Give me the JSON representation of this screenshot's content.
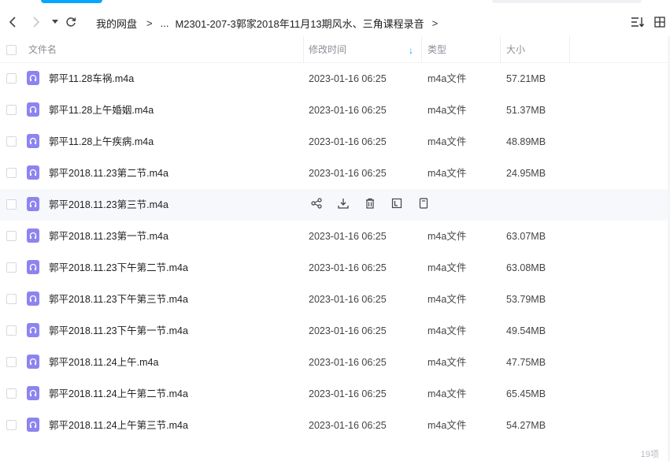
{
  "breadcrumb": {
    "root": "我的网盘",
    "ellipsis": "...",
    "current": "M2301-207-3郭家2018年11月13期风水、三角课程录音"
  },
  "header": {
    "col_name": "文件名",
    "col_modified": "修改时间",
    "col_type": "类型",
    "col_size": "大小"
  },
  "colors": {
    "accent": "#06a7ff",
    "file_icon": "#8d84f0"
  },
  "files": [
    {
      "name": "郭平11.28车祸.m4a",
      "modified": "2023-01-16 06:25",
      "type": "m4a文件",
      "size": "57.21MB"
    },
    {
      "name": "郭平11.28上午婚姻.m4a",
      "modified": "2023-01-16 06:25",
      "type": "m4a文件",
      "size": "51.37MB"
    },
    {
      "name": "郭平11.28上午疾病.m4a",
      "modified": "2023-01-16 06:25",
      "type": "m4a文件",
      "size": "48.89MB"
    },
    {
      "name": "郭平2018.11.23第二节.m4a",
      "modified": "2023-01-16 06:25",
      "type": "m4a文件",
      "size": "24.95MB"
    },
    {
      "name": "郭平2018.11.23第三节.m4a",
      "modified": "",
      "type": "",
      "size": ""
    },
    {
      "name": "郭平2018.11.23第一节.m4a",
      "modified": "2023-01-16 06:25",
      "type": "m4a文件",
      "size": "63.07MB"
    },
    {
      "name": "郭平2018.11.23下午第二节.m4a",
      "modified": "2023-01-16 06:25",
      "type": "m4a文件",
      "size": "63.08MB"
    },
    {
      "name": "郭平2018.11.23下午第三节.m4a",
      "modified": "2023-01-16 06:25",
      "type": "m4a文件",
      "size": "53.79MB"
    },
    {
      "name": "郭平2018.11.23下午第一节.m4a",
      "modified": "2023-01-16 06:25",
      "type": "m4a文件",
      "size": "49.54MB"
    },
    {
      "name": "郭平2018.11.24上午.m4a",
      "modified": "2023-01-16 06:25",
      "type": "m4a文件",
      "size": "47.75MB"
    },
    {
      "name": "郭平2018.11.24上午第二节.m4a",
      "modified": "2023-01-16 06:25",
      "type": "m4a文件",
      "size": "65.45MB"
    },
    {
      "name": "郭平2018.11.24上午第三节.m4a",
      "modified": "2023-01-16 06:25",
      "type": "m4a文件",
      "size": "54.27MB"
    }
  ],
  "footer": {
    "count": "19项"
  }
}
